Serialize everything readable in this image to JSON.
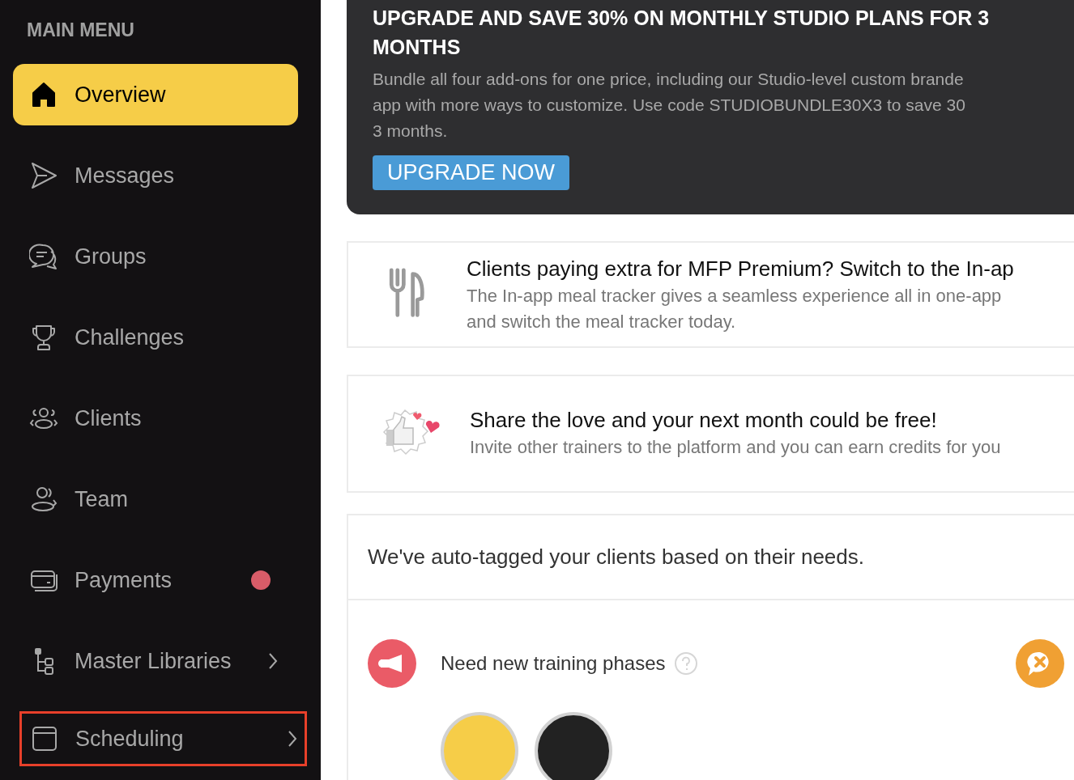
{
  "sidebar": {
    "heading": "MAIN MENU",
    "items": [
      {
        "label": "Overview",
        "selected": true,
        "notification": false,
        "expandable": false,
        "highlighted": false
      },
      {
        "label": "Messages",
        "selected": false,
        "notification": false,
        "expandable": false,
        "highlighted": false
      },
      {
        "label": "Groups",
        "selected": false,
        "notification": false,
        "expandable": false,
        "highlighted": false
      },
      {
        "label": "Challenges",
        "selected": false,
        "notification": false,
        "expandable": false,
        "highlighted": false
      },
      {
        "label": "Clients",
        "selected": false,
        "notification": false,
        "expandable": false,
        "highlighted": false
      },
      {
        "label": "Team",
        "selected": false,
        "notification": false,
        "expandable": false,
        "highlighted": false
      },
      {
        "label": "Payments",
        "selected": false,
        "notification": true,
        "expandable": false,
        "highlighted": false
      },
      {
        "label": "Master Libraries",
        "selected": false,
        "notification": false,
        "expandable": true,
        "highlighted": false
      },
      {
        "label": "Scheduling",
        "selected": false,
        "notification": false,
        "expandable": true,
        "highlighted": true
      }
    ]
  },
  "banner": {
    "title_lines": [
      "UPGRADE AND SAVE 30% ON MONTHLY STUDIO PLANS FOR 3",
      "MONTHS"
    ],
    "body_lines": [
      "Bundle all four add-ons for one price, including our Studio-level custom brande",
      "app with more ways to customize. Use code STUDIOBUNDLE30X3 to save 30",
      "3 months."
    ],
    "button": "UPGRADE NOW"
  },
  "cards": [
    {
      "title": "Clients paying extra for MFP Premium? Switch to the In-ap",
      "body_lines": [
        "The In-app meal tracker gives a seamless experience all in one-app",
        "and switch the meal tracker today."
      ]
    },
    {
      "title": "Share the love and your next month could be free!",
      "body_lines": [
        "Invite other trainers to the platform and you can earn credits for you"
      ]
    }
  ],
  "tags": {
    "heading": "We've auto-tagged your clients based on their needs.",
    "rows": [
      {
        "label": "Need new training phases"
      }
    ]
  }
}
